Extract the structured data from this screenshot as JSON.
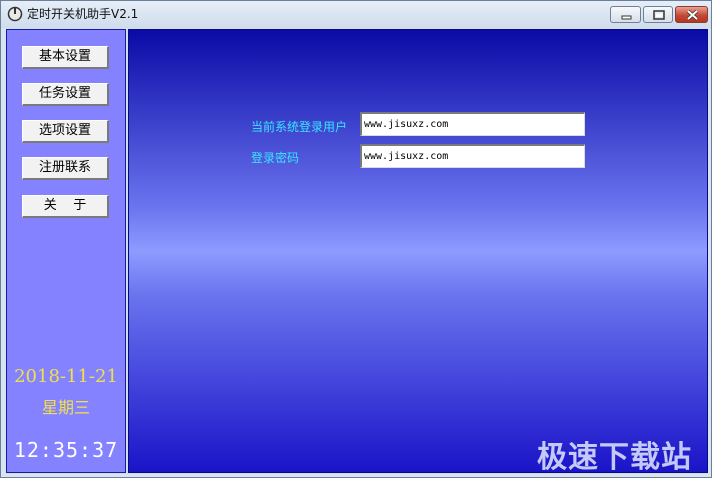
{
  "window": {
    "title": "定时开关机助手V2.1"
  },
  "sidebar": {
    "items": [
      {
        "label": "基本设置"
      },
      {
        "label": "任务设置"
      },
      {
        "label": "选项设置"
      },
      {
        "label": "注册联系"
      },
      {
        "label": "关    于"
      }
    ],
    "date": "2018-11-21",
    "weekday": "星期三",
    "time": "12:35:37"
  },
  "main": {
    "user_label": "当前系统登录用户",
    "user_value": "www.jisuxz.com",
    "password_label": "登录密码",
    "password_value": "www.jisuxz.com",
    "watermark": "极速下载站"
  },
  "colors": {
    "sidebar_bg": "#8482ff",
    "label_cyan": "#38e6ff",
    "date_yellow": "#f1e04a"
  }
}
